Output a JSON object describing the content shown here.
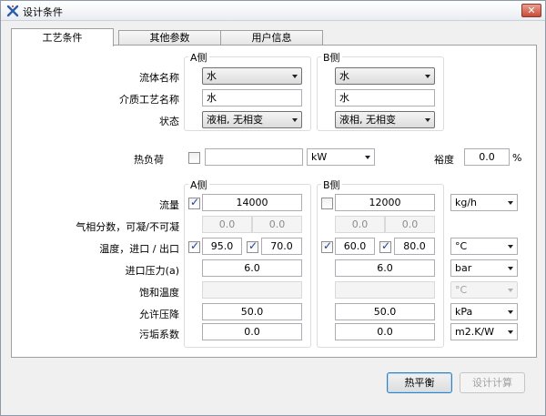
{
  "window": {
    "title": "设计条件",
    "close_glyph": "✕"
  },
  "tabs": [
    "工艺条件",
    "其他参数",
    "用户信息"
  ],
  "top_section": {
    "side_a_title": "A侧",
    "side_b_title": "B侧",
    "labels": {
      "fluid": "流体名称",
      "medium": "介质工艺名称",
      "state": "状态"
    },
    "a": {
      "fluid": "水",
      "medium": "水",
      "state": "液相, 无相变"
    },
    "b": {
      "fluid": "水",
      "medium": "水",
      "state": "液相, 无相变"
    }
  },
  "heat_load": {
    "label": "热负荷",
    "value": "",
    "unit": "kW",
    "checked": false
  },
  "margin": {
    "label": "裕度",
    "value": "0.0",
    "unit": "%"
  },
  "process": {
    "side_a_title": "A侧",
    "side_b_title": "B侧",
    "labels": {
      "flow": "流量",
      "vapor": "气相分数，可凝/不可凝",
      "temp": "温度，进口 / 出口",
      "inlet_pressure": "进口压力(a)",
      "sat_temp": "饱和温度",
      "pressure_drop": "允许压降",
      "fouling": "污垢系数"
    },
    "a": {
      "flow": "14000",
      "flow_checked": true,
      "vapor_cond": "0.0",
      "vapor_noncond": "0.0",
      "temp_in": "95.0",
      "temp_in_checked": true,
      "temp_out": "70.0",
      "temp_out_checked": true,
      "inlet_pressure": "6.0",
      "sat_temp": "",
      "pressure_drop": "50.0",
      "fouling": "0.0"
    },
    "b": {
      "flow": "12000",
      "flow_checked": false,
      "vapor_cond": "0.0",
      "vapor_noncond": "0.0",
      "temp_in": "60.0",
      "temp_in_checked": true,
      "temp_out": "80.0",
      "temp_out_checked": true,
      "inlet_pressure": "6.0",
      "sat_temp": "",
      "pressure_drop": "50.0",
      "fouling": "0.0"
    },
    "units": {
      "flow": "kg/h",
      "temp": "°C",
      "pressure": "bar",
      "sat_temp": "°C",
      "pressure_drop": "kPa",
      "fouling": "m2.K/W"
    }
  },
  "buttons": {
    "heat_balance": "热平衡",
    "design_calc": "设计计算"
  }
}
